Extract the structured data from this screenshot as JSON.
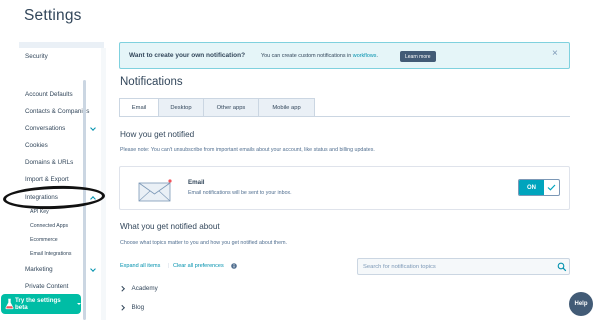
{
  "header": {
    "title": "Settings"
  },
  "sidebar": {
    "items": [
      {
        "label": "Security"
      },
      {
        "label": "Account Defaults"
      },
      {
        "label": "Contacts & Companies"
      },
      {
        "label": "Conversations"
      },
      {
        "label": "Cookies"
      },
      {
        "label": "Domains & URLs"
      },
      {
        "label": "Import & Export"
      },
      {
        "label": "Integrations"
      },
      {
        "label": "Marketing"
      },
      {
        "label": "Private Content"
      }
    ],
    "sub_items": [
      {
        "label": "API Key"
      },
      {
        "label": "Connected Apps"
      },
      {
        "label": "Ecommerce"
      },
      {
        "label": "Email Integrations"
      }
    ],
    "try_beta_label": "Try the settings beta"
  },
  "banner": {
    "title": "Want to create your own notification?",
    "text": "You can create custom notifications in ",
    "link": "workflows",
    "text_end": ".",
    "button": "Learn more",
    "close": "×"
  },
  "main": {
    "title": "Notifications",
    "tabs": [
      {
        "label": "Email"
      },
      {
        "label": "Desktop"
      },
      {
        "label": "Other apps"
      },
      {
        "label": "Mobile app"
      }
    ],
    "how_title": "How you get notified",
    "how_note": "Please note: You can't unsubscribe from important emails about your account, like status and billing updates.",
    "email_card": {
      "title": "Email",
      "description": "Email notifications will be sent to your inbox.",
      "toggle_label": "ON"
    },
    "what_title": "What you get notified about",
    "what_note": "Choose what topics matter to you and how you get notified about them.",
    "expand_all": "Expand all items",
    "clear_all": "Clear all preferences",
    "search_placeholder": "Search for notification topics",
    "topics": [
      {
        "label": "Academy"
      },
      {
        "label": "Blog"
      }
    ]
  },
  "help": {
    "label": "Help"
  },
  "colors": {
    "accent": "#00a4bd",
    "link": "#0091ae",
    "text": "#33475b",
    "beta": "#00bda5",
    "dark": "#425b76"
  }
}
